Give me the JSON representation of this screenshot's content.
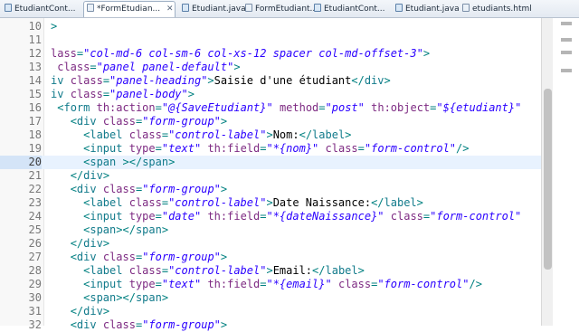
{
  "tabs": [
    {
      "label": "EtudiantCont...",
      "icon": "java-file-icon",
      "active": false,
      "close": ""
    },
    {
      "label": "*FormEtudian...",
      "icon": "html-file-icon",
      "active": true,
      "close": "✕"
    },
    {
      "label": "Etudiant.java",
      "icon": "java-file-icon",
      "active": false,
      "close": ""
    },
    {
      "label": "FormEtudiant...",
      "icon": "html-file-icon",
      "active": false,
      "close": ""
    },
    {
      "label": "EtudiantCont...",
      "icon": "java-file-icon",
      "active": false,
      "close": ""
    },
    {
      "label": "Etudiant.java",
      "icon": "java-file-icon",
      "active": false,
      "close": ""
    },
    {
      "label": "etudiants.html",
      "icon": "html-file-icon",
      "active": false,
      "close": ""
    }
  ],
  "editor": {
    "current_line": 20,
    "lines": [
      {
        "n": "10",
        "tokens": [
          [
            "p",
            ">"
          ]
        ]
      },
      {
        "n": "11",
        "tokens": []
      },
      {
        "n": "12",
        "tokens": [
          [
            "a",
            "lass"
          ],
          [
            "p",
            "="
          ],
          [
            "v",
            "\"col-md-6 col-sm-6 col-xs-12 spacer col-md-offset-3\""
          ],
          [
            "p",
            ">"
          ]
        ]
      },
      {
        "n": "13",
        "tokens": [
          [
            "x",
            " "
          ],
          [
            "a",
            "class"
          ],
          [
            "p",
            "="
          ],
          [
            "v",
            "\"panel panel-default\""
          ],
          [
            "p",
            ">"
          ]
        ]
      },
      {
        "n": "14",
        "tokens": [
          [
            "t",
            "iv"
          ],
          [
            "x",
            " "
          ],
          [
            "a",
            "class"
          ],
          [
            "p",
            "="
          ],
          [
            "v",
            "\"panel-heading\""
          ],
          [
            "p",
            ">"
          ],
          [
            "x",
            "Saisie d'une étudiant"
          ],
          [
            "p",
            "</"
          ],
          [
            "t",
            "div"
          ],
          [
            "p",
            ">"
          ]
        ]
      },
      {
        "n": "15",
        "tokens": [
          [
            "t",
            "iv"
          ],
          [
            "x",
            " "
          ],
          [
            "a",
            "class"
          ],
          [
            "p",
            "="
          ],
          [
            "v",
            "\"panel-body\""
          ],
          [
            "p",
            ">"
          ]
        ]
      },
      {
        "n": "16",
        "tokens": [
          [
            "x",
            " "
          ],
          [
            "p",
            "<"
          ],
          [
            "t",
            "form"
          ],
          [
            "x",
            " "
          ],
          [
            "a",
            "th:action"
          ],
          [
            "p",
            "="
          ],
          [
            "v",
            "\"@{SaveEtudiant}\""
          ],
          [
            "x",
            " "
          ],
          [
            "a",
            "method"
          ],
          [
            "p",
            "="
          ],
          [
            "v",
            "\"post\""
          ],
          [
            "x",
            " "
          ],
          [
            "a",
            "th:object"
          ],
          [
            "p",
            "="
          ],
          [
            "v",
            "\"${etudiant}\""
          ]
        ]
      },
      {
        "n": "17",
        "tokens": [
          [
            "x",
            "   "
          ],
          [
            "p",
            "<"
          ],
          [
            "t",
            "div"
          ],
          [
            "x",
            " "
          ],
          [
            "a",
            "class"
          ],
          [
            "p",
            "="
          ],
          [
            "v",
            "\"form-group\""
          ],
          [
            "p",
            ">"
          ]
        ]
      },
      {
        "n": "18",
        "tokens": [
          [
            "x",
            "     "
          ],
          [
            "p",
            "<"
          ],
          [
            "t",
            "label"
          ],
          [
            "x",
            " "
          ],
          [
            "a",
            "class"
          ],
          [
            "p",
            "="
          ],
          [
            "v",
            "\"control-label\""
          ],
          [
            "p",
            ">"
          ],
          [
            "x",
            "Nom:"
          ],
          [
            "p",
            "</"
          ],
          [
            "t",
            "label"
          ],
          [
            "p",
            ">"
          ]
        ]
      },
      {
        "n": "19",
        "tokens": [
          [
            "x",
            "     "
          ],
          [
            "p",
            "<"
          ],
          [
            "t",
            "input"
          ],
          [
            "x",
            " "
          ],
          [
            "a",
            "type"
          ],
          [
            "p",
            "="
          ],
          [
            "v",
            "\"text\""
          ],
          [
            "x",
            " "
          ],
          [
            "a",
            "th:field"
          ],
          [
            "p",
            "="
          ],
          [
            "v",
            "\"*{nom}\""
          ],
          [
            "x",
            " "
          ],
          [
            "a",
            "class"
          ],
          [
            "p",
            "="
          ],
          [
            "v",
            "\"form-control\""
          ],
          [
            "p",
            "/>"
          ]
        ]
      },
      {
        "n": "20",
        "tokens": [
          [
            "x",
            "     "
          ],
          [
            "p",
            "<"
          ],
          [
            "t",
            "span"
          ],
          [
            "x",
            " "
          ],
          [
            "p",
            "></"
          ],
          [
            "t",
            "span"
          ],
          [
            "p",
            ">"
          ]
        ]
      },
      {
        "n": "21",
        "tokens": [
          [
            "x",
            "   "
          ],
          [
            "p",
            "</"
          ],
          [
            "t",
            "div"
          ],
          [
            "p",
            ">"
          ]
        ]
      },
      {
        "n": "22",
        "tokens": [
          [
            "x",
            "   "
          ],
          [
            "p",
            "<"
          ],
          [
            "t",
            "div"
          ],
          [
            "x",
            " "
          ],
          [
            "a",
            "class"
          ],
          [
            "p",
            "="
          ],
          [
            "v",
            "\"form-group\""
          ],
          [
            "p",
            ">"
          ]
        ]
      },
      {
        "n": "23",
        "tokens": [
          [
            "x",
            "     "
          ],
          [
            "p",
            "<"
          ],
          [
            "t",
            "label"
          ],
          [
            "x",
            " "
          ],
          [
            "a",
            "class"
          ],
          [
            "p",
            "="
          ],
          [
            "v",
            "\"control-label\""
          ],
          [
            "p",
            ">"
          ],
          [
            "x",
            "Date Naissance:"
          ],
          [
            "p",
            "</"
          ],
          [
            "t",
            "label"
          ],
          [
            "p",
            ">"
          ]
        ]
      },
      {
        "n": "24",
        "tokens": [
          [
            "x",
            "     "
          ],
          [
            "p",
            "<"
          ],
          [
            "t",
            "input"
          ],
          [
            "x",
            " "
          ],
          [
            "a",
            "type"
          ],
          [
            "p",
            "="
          ],
          [
            "v",
            "\"date\""
          ],
          [
            "x",
            " "
          ],
          [
            "a",
            "th:field"
          ],
          [
            "p",
            "="
          ],
          [
            "v",
            "\"*{dateNaissance}\""
          ],
          [
            "x",
            " "
          ],
          [
            "a",
            "class"
          ],
          [
            "p",
            "="
          ],
          [
            "v",
            "\"form-control\""
          ]
        ]
      },
      {
        "n": "25",
        "tokens": [
          [
            "x",
            "     "
          ],
          [
            "p",
            "<"
          ],
          [
            "t",
            "span"
          ],
          [
            "p",
            "></"
          ],
          [
            "t",
            "span"
          ],
          [
            "p",
            ">"
          ]
        ]
      },
      {
        "n": "26",
        "tokens": [
          [
            "x",
            "   "
          ],
          [
            "p",
            "</"
          ],
          [
            "t",
            "div"
          ],
          [
            "p",
            ">"
          ]
        ]
      },
      {
        "n": "27",
        "tokens": [
          [
            "x",
            "   "
          ],
          [
            "p",
            "<"
          ],
          [
            "t",
            "div"
          ],
          [
            "x",
            " "
          ],
          [
            "a",
            "class"
          ],
          [
            "p",
            "="
          ],
          [
            "v",
            "\"form-group\""
          ],
          [
            "p",
            ">"
          ]
        ]
      },
      {
        "n": "28",
        "tokens": [
          [
            "x",
            "     "
          ],
          [
            "p",
            "<"
          ],
          [
            "t",
            "label"
          ],
          [
            "x",
            " "
          ],
          [
            "a",
            "class"
          ],
          [
            "p",
            "="
          ],
          [
            "v",
            "\"control-label\""
          ],
          [
            "p",
            ">"
          ],
          [
            "x",
            "Email:"
          ],
          [
            "p",
            "</"
          ],
          [
            "t",
            "label"
          ],
          [
            "p",
            ">"
          ]
        ]
      },
      {
        "n": "29",
        "tokens": [
          [
            "x",
            "     "
          ],
          [
            "p",
            "<"
          ],
          [
            "t",
            "input"
          ],
          [
            "x",
            " "
          ],
          [
            "a",
            "type"
          ],
          [
            "p",
            "="
          ],
          [
            "v",
            "\"text\""
          ],
          [
            "x",
            " "
          ],
          [
            "a",
            "th:field"
          ],
          [
            "p",
            "="
          ],
          [
            "v",
            "\"*{email}\""
          ],
          [
            "x",
            " "
          ],
          [
            "a",
            "class"
          ],
          [
            "p",
            "="
          ],
          [
            "v",
            "\"form-control\""
          ],
          [
            "p",
            "/>"
          ]
        ]
      },
      {
        "n": "30",
        "tokens": [
          [
            "x",
            "     "
          ],
          [
            "p",
            "<"
          ],
          [
            "t",
            "span"
          ],
          [
            "p",
            "></"
          ],
          [
            "t",
            "span"
          ],
          [
            "p",
            ">"
          ]
        ]
      },
      {
        "n": "31",
        "tokens": [
          [
            "x",
            "   "
          ],
          [
            "p",
            "</"
          ],
          [
            "t",
            "div"
          ],
          [
            "p",
            ">"
          ]
        ]
      },
      {
        "n": "32",
        "tokens": [
          [
            "x",
            "   "
          ],
          [
            "p",
            "<"
          ],
          [
            "t",
            "div"
          ],
          [
            "x",
            " "
          ],
          [
            "a",
            "class"
          ],
          [
            "p",
            "="
          ],
          [
            "v",
            "\"form-group\""
          ],
          [
            "p",
            ">"
          ]
        ]
      }
    ]
  },
  "colors": {
    "tag": "#117a8b",
    "attribute": "#7d2a82",
    "value": "#2a00ff",
    "current_line": "#e8f2fe"
  }
}
